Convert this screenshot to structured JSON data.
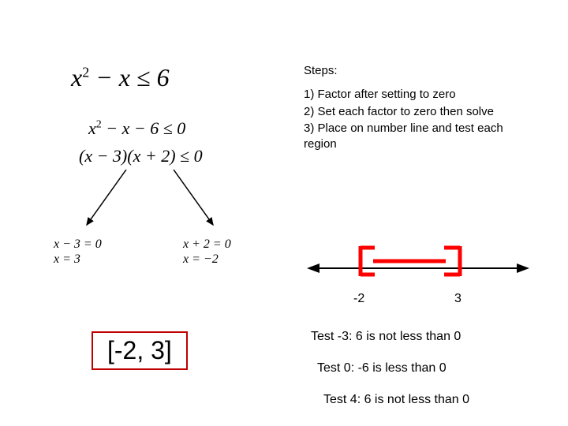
{
  "math": {
    "main_html": "x<sup>2</sup> − x ≤ 6",
    "sub1_html": "x<sup>2</sup> − x − 6 ≤ 0",
    "sub2": "(x − 3)(x + 2) ≤ 0",
    "factor_left_eq": "x − 3 = 0",
    "factor_left_sol": "x = 3",
    "factor_right_eq": "x + 2 = 0",
    "factor_right_sol": "x = −2"
  },
  "steps": {
    "title": "Steps:",
    "s1": "1) Factor after setting to zero",
    "s2": "2) Set each factor to zero then solve",
    "s3": "3) Place on number line and test each region"
  },
  "numline": {
    "label_a": "-2",
    "label_b": "3"
  },
  "answer": "[-2, 3]",
  "tests": {
    "t1": "Test -3:  6 is not less than 0",
    "t2": "Test 0:  -6 is less than 0",
    "t3": "Test 4:  6 is not less than 0"
  }
}
